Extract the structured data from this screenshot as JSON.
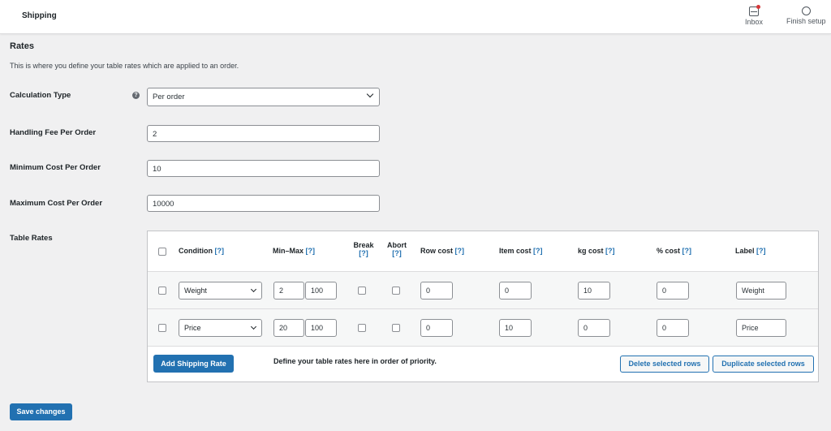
{
  "header": {
    "title": "Shipping",
    "actions": [
      {
        "label": "Inbox",
        "icon": "inbox-icon"
      },
      {
        "label": "Finish setup",
        "icon": "circle-icon"
      }
    ]
  },
  "section": {
    "title": "Rates",
    "description": "This is where you define your table rates which are applied to an order."
  },
  "fields": {
    "calculation_type": {
      "label": "Calculation Type",
      "value": "Per order"
    },
    "handling_fee": {
      "label": "Handling Fee Per Order",
      "value": "2"
    },
    "min_cost": {
      "label": "Minimum Cost Per Order",
      "value": "10"
    },
    "max_cost": {
      "label": "Maximum Cost Per Order",
      "value": "10000"
    },
    "table_rates": {
      "label": "Table Rates"
    }
  },
  "table": {
    "headers": {
      "condition": "Condition",
      "minmax": "Min–Max",
      "break": "Break",
      "abort": "Abort",
      "row_cost": "Row cost",
      "item_cost": "Item cost",
      "kg_cost": "kg cost",
      "pct_cost": "% cost",
      "label": "Label",
      "help": "[?]"
    },
    "rows": [
      {
        "condition": "Weight",
        "min": "2",
        "max": "100",
        "row_cost": "0",
        "item_cost": "0",
        "kg_cost": "10",
        "pct_cost": "0",
        "label": "Weight"
      },
      {
        "condition": "Price",
        "min": "20",
        "max": "100",
        "row_cost": "0",
        "item_cost": "10",
        "kg_cost": "0",
        "pct_cost": "0",
        "label": "Price"
      }
    ],
    "add_button": "Add Shipping Rate",
    "note": "Define your table rates here in order of priority.",
    "delete_button": "Delete selected rows",
    "duplicate_button": "Duplicate selected rows"
  },
  "save_button": "Save changes",
  "colors": {
    "primary": "#2271b1",
    "notification": "#d63638"
  }
}
